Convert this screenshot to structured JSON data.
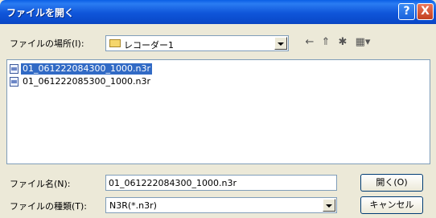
{
  "window": {
    "title": "ファイルを開く",
    "help_button": "?",
    "close_button": "X"
  },
  "look_in": {
    "label": "ファイルの場所(I):",
    "value": "レコーダー1"
  },
  "toolbar": {
    "icons": [
      "back-icon",
      "up-folder-icon",
      "new-folder-icon",
      "view-menu-icon"
    ]
  },
  "files": [
    {
      "name": "01_061222084300_1000.n3r",
      "selected": true
    },
    {
      "name": "01_061222085300_1000.n3r",
      "selected": false
    }
  ],
  "filename": {
    "label": "ファイル名(N):",
    "value": "01_061222084300_1000.n3r"
  },
  "filetype": {
    "label": "ファイルの種類(T):",
    "value": "N3R(*.n3r)"
  },
  "buttons": {
    "open": "開く(O)",
    "cancel": "キャンセル"
  },
  "colors": {
    "title_bar": "#0a55d9",
    "selection": "#316ac5",
    "dialog_bg": "#ece9d8"
  }
}
